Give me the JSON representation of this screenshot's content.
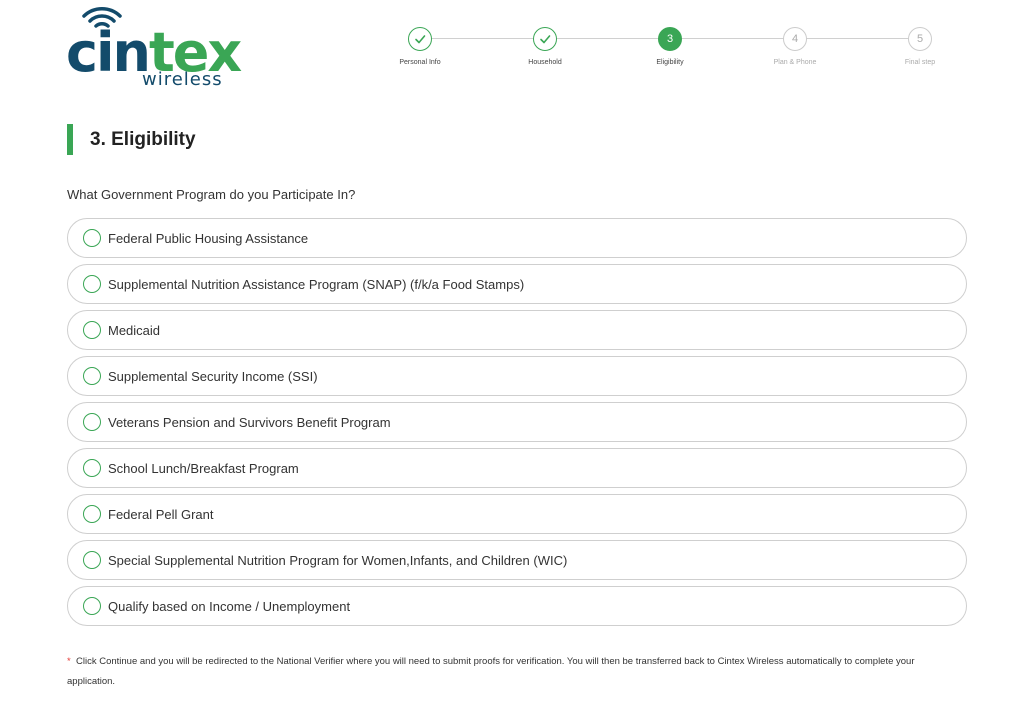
{
  "brand": {
    "name_part1": "cin",
    "name_part2": "tex",
    "sub": "wireless",
    "primary_color": "#134b6b",
    "accent_color": "#3aa655"
  },
  "stepper": {
    "steps": [
      {
        "number": "1",
        "label": "Personal Info",
        "status": "done"
      },
      {
        "number": "2",
        "label": "Household",
        "status": "done"
      },
      {
        "number": "3",
        "label": "Eligibility",
        "status": "active"
      },
      {
        "number": "4",
        "label": "Plan & Phone",
        "status": "todo"
      },
      {
        "number": "5",
        "label": "Final step",
        "status": "todo"
      }
    ]
  },
  "section": {
    "title": "3. Eligibility"
  },
  "question": "What Government Program do you Participate In?",
  "options": [
    "Federal Public Housing Assistance",
    "Supplemental Nutrition Assistance Program (SNAP) (f/k/a Food Stamps)",
    "Medicaid",
    "Supplemental Security Income (SSI)",
    "Veterans Pension and Survivors Benefit Program",
    "School Lunch/Breakfast Program",
    "Federal Pell Grant",
    "Special Supplemental Nutrition Program for Women,Infants, and Children (WIC)",
    "Qualify based on Income / Unemployment"
  ],
  "note": {
    "asterisk": "*",
    "text": "Click Continue and you will be redirected to the National Verifier where you will need to submit proofs for verification. You will then be transferred back to Cintex Wireless automatically to complete your application."
  }
}
